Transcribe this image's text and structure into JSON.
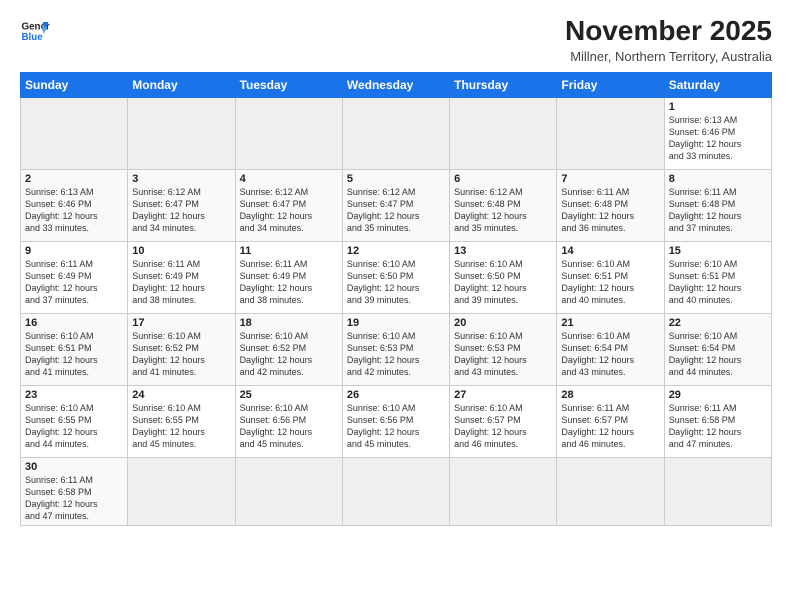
{
  "logo": {
    "line1": "General",
    "line2": "Blue"
  },
  "title": "November 2025",
  "subtitle": "Millner, Northern Territory, Australia",
  "days_of_week": [
    "Sunday",
    "Monday",
    "Tuesday",
    "Wednesday",
    "Thursday",
    "Friday",
    "Saturday"
  ],
  "weeks": [
    [
      {
        "num": "",
        "info": "",
        "empty": true
      },
      {
        "num": "",
        "info": "",
        "empty": true
      },
      {
        "num": "",
        "info": "",
        "empty": true
      },
      {
        "num": "",
        "info": "",
        "empty": true
      },
      {
        "num": "",
        "info": "",
        "empty": true
      },
      {
        "num": "",
        "info": "",
        "empty": true
      },
      {
        "num": "1",
        "info": "Sunrise: 6:13 AM\nSunset: 6:46 PM\nDaylight: 12 hours\nand 33 minutes."
      }
    ],
    [
      {
        "num": "2",
        "info": "Sunrise: 6:13 AM\nSunset: 6:46 PM\nDaylight: 12 hours\nand 33 minutes."
      },
      {
        "num": "3",
        "info": "Sunrise: 6:12 AM\nSunset: 6:47 PM\nDaylight: 12 hours\nand 34 minutes."
      },
      {
        "num": "4",
        "info": "Sunrise: 6:12 AM\nSunset: 6:47 PM\nDaylight: 12 hours\nand 34 minutes."
      },
      {
        "num": "5",
        "info": "Sunrise: 6:12 AM\nSunset: 6:47 PM\nDaylight: 12 hours\nand 35 minutes."
      },
      {
        "num": "6",
        "info": "Sunrise: 6:12 AM\nSunset: 6:48 PM\nDaylight: 12 hours\nand 35 minutes."
      },
      {
        "num": "7",
        "info": "Sunrise: 6:11 AM\nSunset: 6:48 PM\nDaylight: 12 hours\nand 36 minutes."
      },
      {
        "num": "8",
        "info": "Sunrise: 6:11 AM\nSunset: 6:48 PM\nDaylight: 12 hours\nand 37 minutes."
      }
    ],
    [
      {
        "num": "9",
        "info": "Sunrise: 6:11 AM\nSunset: 6:49 PM\nDaylight: 12 hours\nand 37 minutes."
      },
      {
        "num": "10",
        "info": "Sunrise: 6:11 AM\nSunset: 6:49 PM\nDaylight: 12 hours\nand 38 minutes."
      },
      {
        "num": "11",
        "info": "Sunrise: 6:11 AM\nSunset: 6:49 PM\nDaylight: 12 hours\nand 38 minutes."
      },
      {
        "num": "12",
        "info": "Sunrise: 6:10 AM\nSunset: 6:50 PM\nDaylight: 12 hours\nand 39 minutes."
      },
      {
        "num": "13",
        "info": "Sunrise: 6:10 AM\nSunset: 6:50 PM\nDaylight: 12 hours\nand 39 minutes."
      },
      {
        "num": "14",
        "info": "Sunrise: 6:10 AM\nSunset: 6:51 PM\nDaylight: 12 hours\nand 40 minutes."
      },
      {
        "num": "15",
        "info": "Sunrise: 6:10 AM\nSunset: 6:51 PM\nDaylight: 12 hours\nand 40 minutes."
      }
    ],
    [
      {
        "num": "16",
        "info": "Sunrise: 6:10 AM\nSunset: 6:51 PM\nDaylight: 12 hours\nand 41 minutes."
      },
      {
        "num": "17",
        "info": "Sunrise: 6:10 AM\nSunset: 6:52 PM\nDaylight: 12 hours\nand 41 minutes."
      },
      {
        "num": "18",
        "info": "Sunrise: 6:10 AM\nSunset: 6:52 PM\nDaylight: 12 hours\nand 42 minutes."
      },
      {
        "num": "19",
        "info": "Sunrise: 6:10 AM\nSunset: 6:53 PM\nDaylight: 12 hours\nand 42 minutes."
      },
      {
        "num": "20",
        "info": "Sunrise: 6:10 AM\nSunset: 6:53 PM\nDaylight: 12 hours\nand 43 minutes."
      },
      {
        "num": "21",
        "info": "Sunrise: 6:10 AM\nSunset: 6:54 PM\nDaylight: 12 hours\nand 43 minutes."
      },
      {
        "num": "22",
        "info": "Sunrise: 6:10 AM\nSunset: 6:54 PM\nDaylight: 12 hours\nand 44 minutes."
      }
    ],
    [
      {
        "num": "23",
        "info": "Sunrise: 6:10 AM\nSunset: 6:55 PM\nDaylight: 12 hours\nand 44 minutes."
      },
      {
        "num": "24",
        "info": "Sunrise: 6:10 AM\nSunset: 6:55 PM\nDaylight: 12 hours\nand 45 minutes."
      },
      {
        "num": "25",
        "info": "Sunrise: 6:10 AM\nSunset: 6:56 PM\nDaylight: 12 hours\nand 45 minutes."
      },
      {
        "num": "26",
        "info": "Sunrise: 6:10 AM\nSunset: 6:56 PM\nDaylight: 12 hours\nand 45 minutes."
      },
      {
        "num": "27",
        "info": "Sunrise: 6:10 AM\nSunset: 6:57 PM\nDaylight: 12 hours\nand 46 minutes."
      },
      {
        "num": "28",
        "info": "Sunrise: 6:11 AM\nSunset: 6:57 PM\nDaylight: 12 hours\nand 46 minutes."
      },
      {
        "num": "29",
        "info": "Sunrise: 6:11 AM\nSunset: 6:58 PM\nDaylight: 12 hours\nand 47 minutes."
      }
    ],
    [
      {
        "num": "30",
        "info": "Sunrise: 6:11 AM\nSunset: 6:58 PM\nDaylight: 12 hours\nand 47 minutes."
      },
      {
        "num": "",
        "info": "",
        "empty": true
      },
      {
        "num": "",
        "info": "",
        "empty": true
      },
      {
        "num": "",
        "info": "",
        "empty": true
      },
      {
        "num": "",
        "info": "",
        "empty": true
      },
      {
        "num": "",
        "info": "",
        "empty": true
      },
      {
        "num": "",
        "info": "",
        "empty": true
      }
    ]
  ]
}
